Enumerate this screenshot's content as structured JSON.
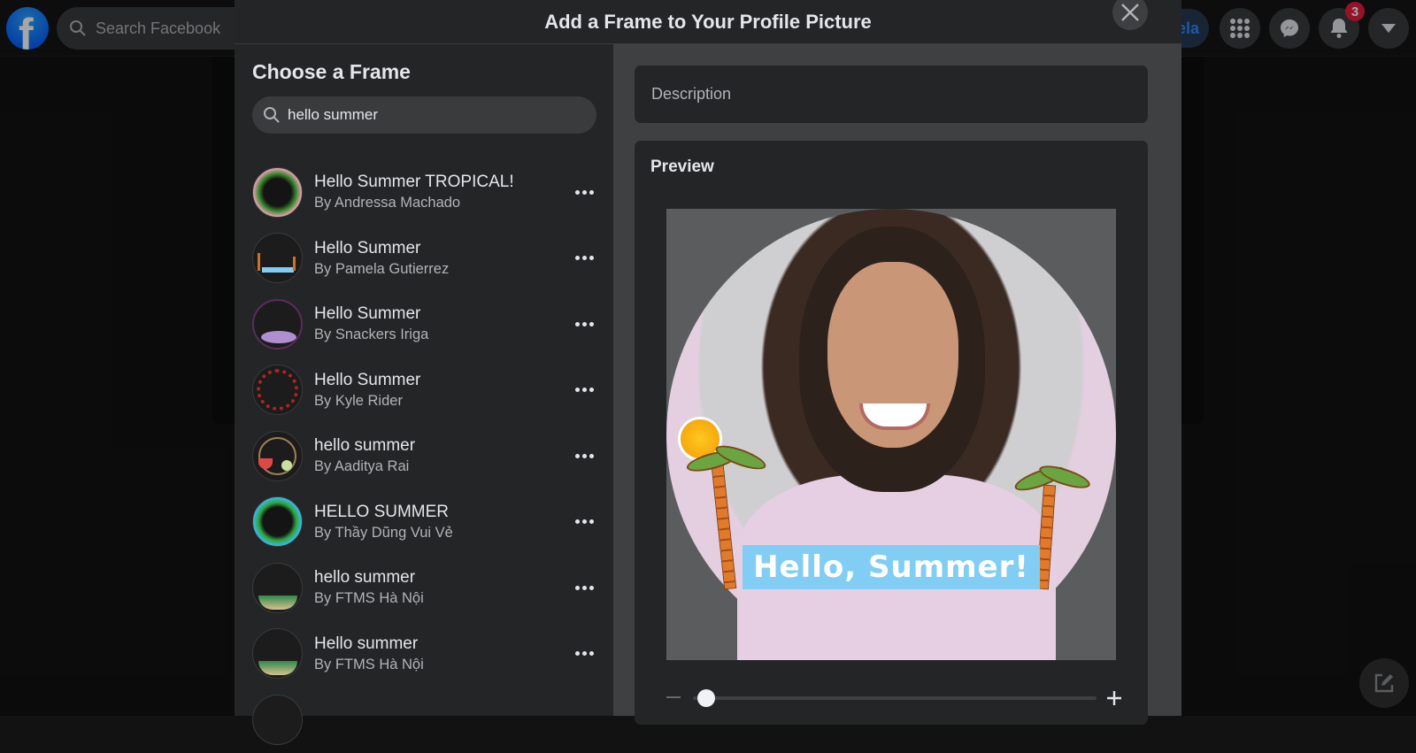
{
  "topnav": {
    "logo": "facebook-logo",
    "logo_letter": "f",
    "search_placeholder": "Search Facebook",
    "profile_name": "Pamela",
    "notification_count": "3",
    "icons": [
      "menu-grid-icon",
      "messenger-icon",
      "bell-icon",
      "caret-down-icon"
    ]
  },
  "modal": {
    "title": "Add a Frame to Your Profile Picture",
    "close_icon": "close-icon",
    "left": {
      "heading": "Choose a Frame",
      "search_value": "hello summer",
      "frames": [
        {
          "title": "Hello Summer TROPICAL!",
          "author": "By Andressa Machado"
        },
        {
          "title": "Hello Summer",
          "author": "By Pamela Gutierrez"
        },
        {
          "title": "Hello Summer",
          "author": "By Snackers Iriga"
        },
        {
          "title": "Hello Summer",
          "author": "By Kyle Rider"
        },
        {
          "title": "hello summer",
          "author": "By Aaditya Rai"
        },
        {
          "title": "HELLO SUMMER",
          "author": "By Thầy Dũng Vui Vẻ"
        },
        {
          "title": "hello summer",
          "author": "By FTMS Hà Nội"
        },
        {
          "title": "Hello summer",
          "author": "By FTMS Hà Nội"
        }
      ]
    },
    "right": {
      "description_placeholder": "Description",
      "preview_heading": "Preview",
      "frame_banner_text": "Hello, Summer!",
      "zoom_level_fraction": 0.02
    }
  },
  "colors": {
    "accent": "#2d88ff",
    "badge": "#e41e3f",
    "banner": "#82cdf3",
    "panel": "#242526",
    "panel_alt": "#3e4042"
  }
}
